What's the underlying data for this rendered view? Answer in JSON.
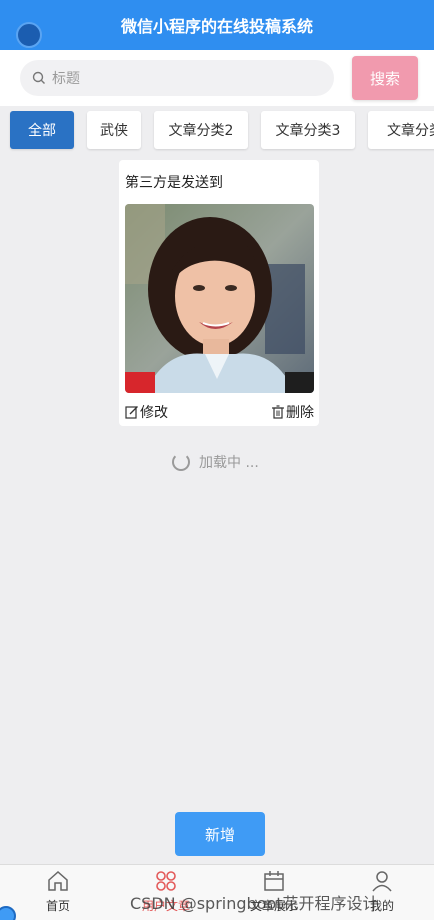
{
  "header": {
    "title": "微信小程序的在线投稿系统"
  },
  "search": {
    "placeholder": "标题",
    "button_label": "搜索"
  },
  "categories": [
    {
      "label": "全部",
      "active": true
    },
    {
      "label": "武侠"
    },
    {
      "label": "文章分类2"
    },
    {
      "label": "文章分类3"
    },
    {
      "label": "文章分类"
    }
  ],
  "card": {
    "title": "第三方是发送到",
    "edit_label": "修改",
    "delete_label": "删除"
  },
  "loading_text": "加载中 ...",
  "add_button_label": "新增",
  "tabs": [
    {
      "label": "首页",
      "icon": "home-icon"
    },
    {
      "label": "用户文章",
      "icon": "grid-icon",
      "active": true
    },
    {
      "label": "文章展示",
      "icon": "calendar-icon"
    },
    {
      "label": "我的",
      "icon": "user-icon"
    }
  ],
  "watermark": "CSDN @springboot花开程序设计",
  "colors": {
    "header": "#2f8ef0",
    "search_button": "#f19aae",
    "category_active": "#2a72c4",
    "add_button": "#3f9bf5",
    "tab_active": "#e35a5a"
  }
}
